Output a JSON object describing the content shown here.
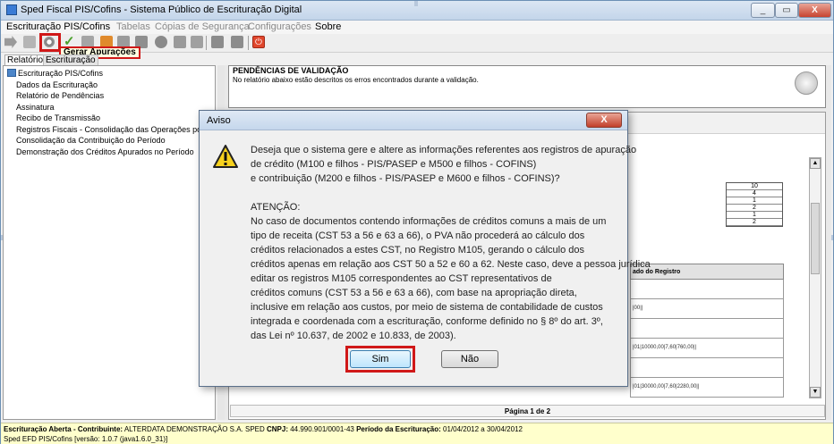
{
  "window": {
    "title": "Sped Fiscal PIS/Cofins - Sistema Público de Escrituração Digital",
    "controls": [
      "_",
      "▭",
      "X"
    ]
  },
  "menu": {
    "items": [
      {
        "label": "Escrituração PIS/Cofins",
        "enabled": true
      },
      {
        "label": "Tabelas",
        "enabled": false
      },
      {
        "label": "Cópias de Segurança",
        "enabled": false
      },
      {
        "label": "Configurações",
        "enabled": false
      },
      {
        "label": "Sobre",
        "enabled": true
      }
    ]
  },
  "toolbar": {
    "tooltip": "Gerar Apurações",
    "icons": [
      "arrow-right-icon",
      "folder-open-icon",
      "gear-apuracao-icon",
      "check-icon",
      "printer-icon",
      "cancel-icon",
      "tools-icon",
      "people-icon",
      "globe-icon",
      "book-icon",
      "download-icon",
      "save-icon",
      "save-as-icon",
      "power-icon"
    ]
  },
  "left_panel": {
    "tabs": [
      "Relatórios",
      "Escrituração"
    ],
    "tree": {
      "root": "Escrituração PIS/Cofins",
      "items": [
        "Dados da Escrituração",
        "Relatório de Pendências",
        "Assinatura",
        "Recibo de Transmissão",
        "Registros Fiscais - Consolidação das Operações por CST",
        "Consolidação da Contribuição do Período",
        "Demonstração dos Créditos Apurados no Período"
      ]
    }
  },
  "pendencias": {
    "heading": "PENDÊNCIAS DE VALIDAÇÃO",
    "description": "No relatório abaixo estão descritos os erros encontrados durante a validação."
  },
  "report": {
    "counts": [
      "10",
      "4",
      "1",
      "2",
      "1",
      "2"
    ],
    "column_header": "ado do Registro",
    "row_fragments": [
      "|00||",
      "|01|10000,00|7,60|760,00||",
      "|01|30000,00|7,60|2280,00||"
    ],
    "page_label": "Página 1 de 2"
  },
  "dialog": {
    "title": "Aviso",
    "close_label": "X",
    "lines": [
      "Deseja que o sistema gere e altere as informações referentes aos registros de apuração",
      "de crédito (M100 e filhos - PIS/PASEP e M500 e filhos - COFINS)",
      "e contribuição (M200 e filhos - PIS/PASEP e M600 e filhos - COFINS)?",
      "",
      "ATENÇÃO:",
      "No caso de documentos contendo informações de créditos comuns a mais de um",
      " tipo de receita (CST 53 a 56 e 63 a 66), o PVA não procederá ao cálculo dos",
      " créditos relacionados a estes CST, no Registro M105, gerando o cálculo dos",
      " créditos apenas em relação aos CST 50 a 52 e 60 a 62. Neste caso, deve a pessoa jurídica",
      " editar os registros M105 correspondentes ao CST representativos de",
      " créditos comuns (CST 53 a 56 e 63 a 66), com base na apropriação direta,",
      " inclusive em relação aos custos, por meio de sistema de contabilidade de custos",
      " integrada e coordenada com a escrituração, conforme definido no § 8º do art. 3º,",
      " das Lei nº 10.637, de 2002 e 10.833, de 2003)."
    ],
    "yes_label": "Sim",
    "no_label": "Não"
  },
  "status": {
    "line1_a": "Escrituração Aberta - Contribuinte:",
    "line1_b": " ALTERDATA DEMONSTRAÇÃO S.A. SPED ",
    "line1_c": "CNPJ:",
    "line1_d": " 44.990.901/0001-43 ",
    "line1_e": "Período da Escrituração:",
    "line1_f": " 01/04/2012 a 30/04/2012",
    "line2": "Sped EFD PIS/Cofins [versão: 1.0.7 (java1.6.0_31)]"
  },
  "colors": {
    "highlight": "#d01818",
    "status_bg": "#ffffcc",
    "titlebar": "#c5d7ec"
  }
}
